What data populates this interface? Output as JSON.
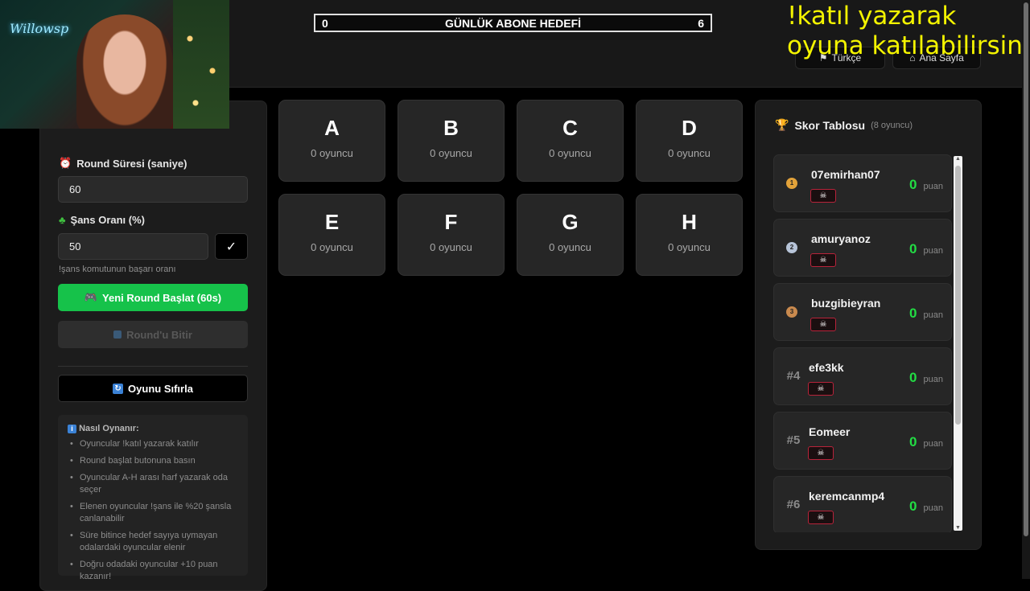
{
  "goal": {
    "left": "0",
    "title": "GÜNLÜK ABONE HEDEFİ",
    "right": "6"
  },
  "overlay": {
    "line1": "!katıl yazarak",
    "line2": "oyuna katılabilirsiniz"
  },
  "webcam": {
    "neon_text": "Willowsp"
  },
  "nav": {
    "language": "Türkçe",
    "home": "Ana Sayfa"
  },
  "controls": {
    "round_label": "Round Süresi (saniye)",
    "round_value": "60",
    "chance_label": "Şans Oranı (%)",
    "chance_value": "50",
    "confirm": "✓",
    "chance_hint": "!şans komutunun başarı oranı",
    "start_button": "Yeni Round Başlat (60s)",
    "end_button": "Round'u Bitir",
    "reset_button": "Oyunu Sıfırla"
  },
  "howto": {
    "title": "Nasıl Oynanır:",
    "items": [
      "Oyuncular !katıl yazarak katılır",
      "Round başlat butonuna basın",
      "Oyuncular A-H arası harf yazarak oda seçer",
      "Elenen oyuncular !şans ile %20 şansla canlanabilir",
      "Süre bitince hedef sayıya uymayan odalardaki oyuncular elenir",
      "Doğru odadaki oyuncular +10 puan kazanır!"
    ]
  },
  "rooms": [
    {
      "letter": "A",
      "count": "0 oyuncu"
    },
    {
      "letter": "B",
      "count": "0 oyuncu"
    },
    {
      "letter": "C",
      "count": "0 oyuncu"
    },
    {
      "letter": "D",
      "count": "0 oyuncu"
    },
    {
      "letter": "E",
      "count": "0 oyuncu"
    },
    {
      "letter": "F",
      "count": "0 oyuncu"
    },
    {
      "letter": "G",
      "count": "0 oyuncu"
    },
    {
      "letter": "H",
      "count": "0 oyuncu"
    }
  ],
  "scoreboard": {
    "title": "Skor Tablosu",
    "subtitle": "(8 oyuncu)",
    "unit": "puan",
    "players": [
      {
        "rank": "1",
        "medal": "gold",
        "name": "07emirhan07",
        "score": "0"
      },
      {
        "rank": "2",
        "medal": "silver",
        "name": "amuryanoz",
        "score": "0"
      },
      {
        "rank": "3",
        "medal": "bronze",
        "name": "buzgibieyran",
        "score": "0"
      },
      {
        "rank": "#4",
        "medal": "",
        "name": "efe3kk",
        "score": "0"
      },
      {
        "rank": "#5",
        "medal": "",
        "name": "Eomeer",
        "score": "0"
      },
      {
        "rank": "#6",
        "medal": "",
        "name": "keremcanmp4",
        "score": "0"
      }
    ]
  },
  "colors": {
    "accent_green": "#16c24a",
    "score_green": "#22dd44",
    "overlay_yellow": "#f4f400"
  }
}
